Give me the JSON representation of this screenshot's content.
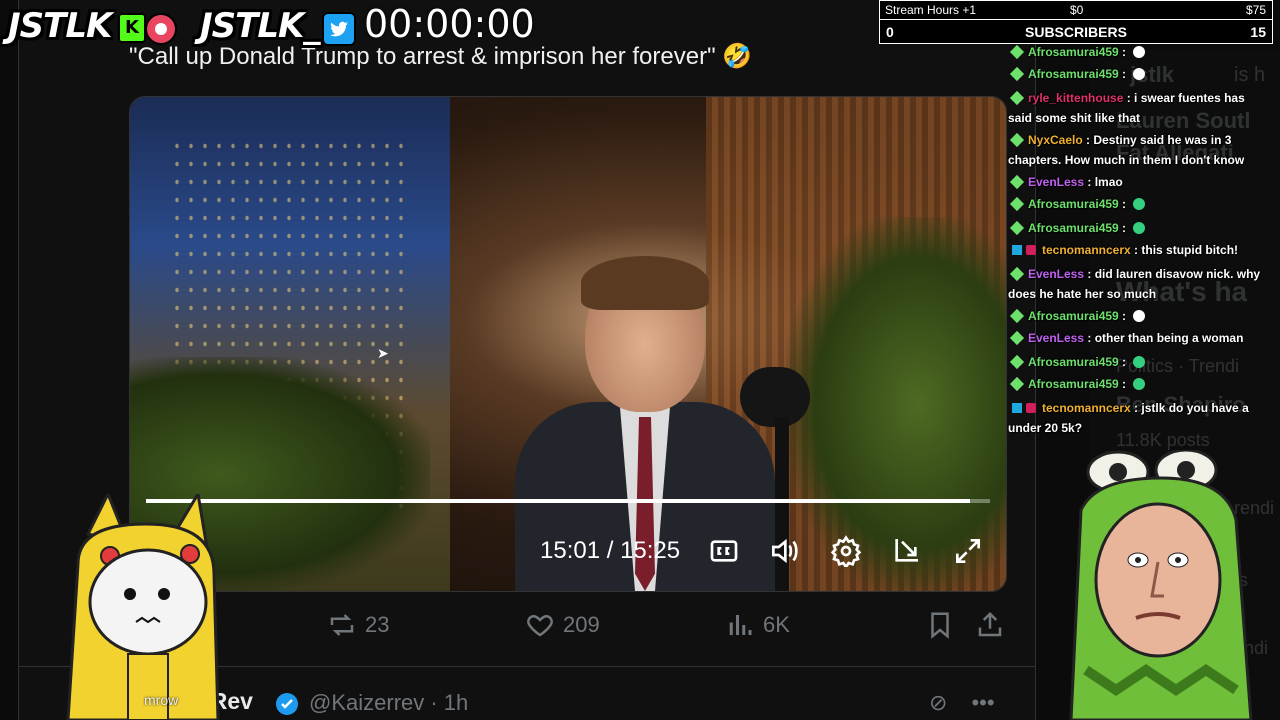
{
  "overlay": {
    "logo_left": "JSTLK",
    "kick_badge": "K",
    "logo_right": "JSTLK_",
    "timer": "00:00:00"
  },
  "stats": {
    "label": "Stream Hours +1",
    "amount_low": "$0",
    "amount_high": "$75",
    "subs_label": "SUBSCRIBERS",
    "subs_current": "0",
    "subs_goal": "15"
  },
  "tweet": {
    "text": "\"Call up Donald Trump to arrest & imprison her forever\" 🤣",
    "video": {
      "time": "15:01 / 15:25",
      "progress": 0.976
    },
    "actions": {
      "retweets": "23",
      "likes": "209",
      "views": "6K"
    }
  },
  "reply": {
    "name": "erRev",
    "handle": "@Kaizerrev · 1h"
  },
  "avatar_caption": "mrow",
  "chat": [
    {
      "user": "Afrosamurai459",
      "color": "#6ee06e",
      "text": "",
      "emote": "white"
    },
    {
      "user": "Afrosamurai459",
      "color": "#6ee06e",
      "text": "",
      "emote": "white"
    },
    {
      "user": "ryle_kittenhouse",
      "color": "#e0306a",
      "text": "i swear fuentes has said some shit like that"
    },
    {
      "user": "NyxCaelo",
      "color": "#f0b030",
      "text": "Destiny said he was in 3 chapters. How much in them I don't know"
    },
    {
      "user": "EvenLess",
      "color": "#c060f0",
      "text": "lmao"
    },
    {
      "user": "Afrosamurai459",
      "color": "#6ee06e",
      "text": "",
      "emote": "green"
    },
    {
      "user": "Afrosamurai459",
      "color": "#6ee06e",
      "text": "",
      "emote": "green"
    },
    {
      "user": "tecnomanncerx",
      "color": "#f0b030",
      "text": "this stupid bitch!"
    },
    {
      "user": "EvenLess",
      "color": "#c060f0",
      "text": "did lauren disavow nick. why does he hate her so much"
    },
    {
      "user": "Afrosamurai459",
      "color": "#6ee06e",
      "text": "",
      "emote": "white"
    },
    {
      "user": "EvenLess",
      "color": "#c060f0",
      "text": "other than being a woman"
    },
    {
      "user": "Afrosamurai459",
      "color": "#6ee06e",
      "text": "",
      "emote": "green"
    },
    {
      "user": "Afrosamurai459",
      "color": "#6ee06e",
      "text": "",
      "emote": "green"
    },
    {
      "user": "tecnomanncerx",
      "color": "#f0b030",
      "text": "jstlk do you have a under 20 5k?"
    }
  ],
  "background_sidebar": {
    "t1": "jstlk",
    "t1b": "is h",
    "t2": "Lauren Soutl",
    "t3": "Fat Allegati",
    "t4": "What's ha",
    "t5": "Politics · Trendi",
    "t6": "Ben Shapiro",
    "t7": "11.8K posts",
    "t8": "rendi",
    "t9": "ts",
    "t10": "endi"
  }
}
